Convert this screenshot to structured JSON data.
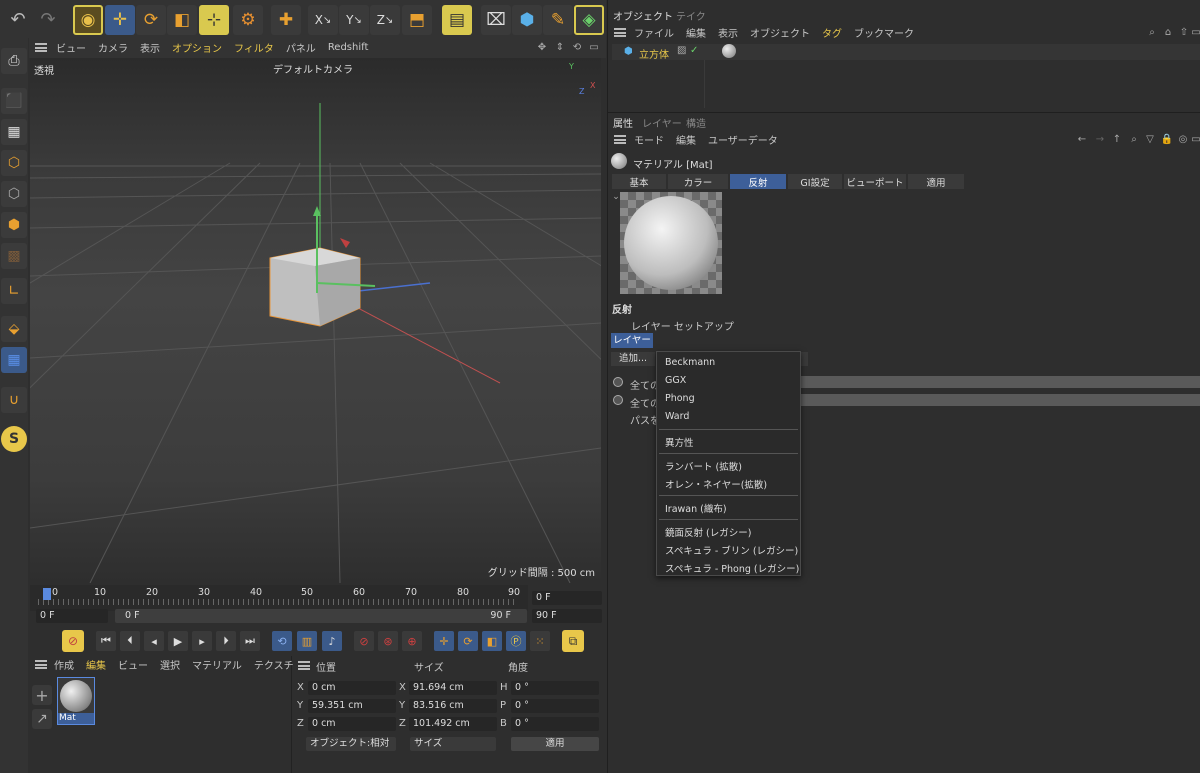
{
  "top_menu": {
    "items": [
      "ビュー",
      "カメラ",
      "表示",
      "オプション",
      "フィルタ",
      "パネル",
      "Redshift"
    ]
  },
  "viewport": {
    "label": "透視",
    "camera": "デフォルトカメラ",
    "grid": "グリッド間隔 : 500 cm",
    "axis_y": "Y",
    "axis_x": "X",
    "axis_z": "Z"
  },
  "timeline": {
    "ticks": [
      "0",
      "10",
      "20",
      "30",
      "40",
      "50",
      "60",
      "70",
      "80",
      "90"
    ],
    "current_frame": "0 F",
    "start": "0 F",
    "range_start": "0 F",
    "range_end": "90 F",
    "end": "90 F",
    "end2": "90 F"
  },
  "obj_panel": {
    "tabs": [
      "オブジェクト",
      "テイク"
    ],
    "menu": [
      "ファイル",
      "編集",
      "表示",
      "オブジェクト",
      "タグ",
      "ブックマーク"
    ],
    "object_name": "立方体"
  },
  "attr_panel": {
    "tabs": [
      "属性",
      "レイヤー",
      "構造"
    ],
    "menu": [
      "モード",
      "編集",
      "ユーザーデータ"
    ],
    "material_title": "マテリアル [Mat]",
    "mat_tabs": [
      "基本",
      "カラー",
      "反射",
      "GI設定",
      "ビューポート",
      "適用"
    ],
    "section": "反射",
    "layer_setup": "レイヤー セットアップ",
    "layer_btn": "レイヤー",
    "add_btn": "追加...",
    "row1": "全ての",
    "row2": "全ての",
    "row3": "パスを"
  },
  "dropdown": {
    "items": [
      "Beckmann",
      "GGX",
      "Phong",
      "Ward",
      "異方性",
      "ランバート (拡散)",
      "オレン・ネイヤー(拡散)",
      "Irawan (織布)",
      "鏡面反射 (レガシー)",
      "スペキュラ - ブリン (レガシー)",
      "スペキュラ - Phong (レガシー)"
    ]
  },
  "mat_manager": {
    "menu": [
      "作成",
      "編集",
      "ビュー",
      "選択",
      "マテリアル",
      "テクスチャ"
    ],
    "mat_name": "Mat"
  },
  "coords": {
    "headers": [
      "位置",
      "サイズ",
      "角度"
    ],
    "rows": [
      {
        "axis": "X",
        "pos": "0 cm",
        "saxis": "X",
        "size": "91.694 cm",
        "aaxis": "H",
        "angle": "0 °"
      },
      {
        "axis": "Y",
        "pos": "59.351 cm",
        "saxis": "Y",
        "size": "83.516 cm",
        "aaxis": "P",
        "angle": "0 °"
      },
      {
        "axis": "Z",
        "pos": "0 cm",
        "saxis": "Z",
        "size": "101.492 cm",
        "aaxis": "B",
        "angle": "0 °"
      }
    ],
    "mode_select": "オブジェクト:相対",
    "size_select": "サイズ",
    "apply": "適用"
  },
  "colors": {
    "accent": "#e8c74a",
    "selected": "#3d5f99",
    "bg": "#2e2e2e"
  }
}
